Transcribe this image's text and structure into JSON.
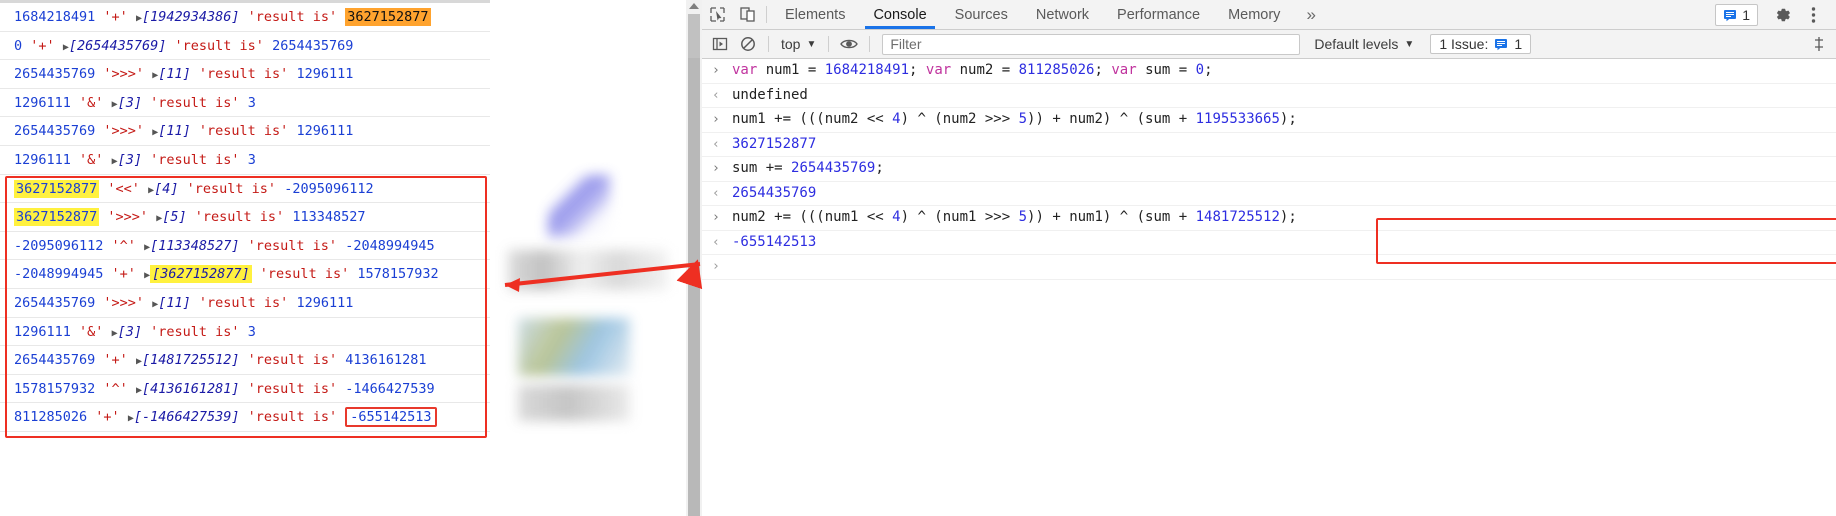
{
  "left_log": {
    "rows": [
      {
        "a": "1684218491",
        "op": "'+'",
        "arr": "[1942934386]",
        "label": "'result is'",
        "res": "3627152877",
        "a_hl": "none",
        "arr_hl": "none",
        "res_hl": "orange"
      },
      {
        "a": "0",
        "op": "'+'",
        "arr": "[2654435769]",
        "label": "'result is'",
        "res": "2654435769",
        "a_hl": "none",
        "arr_hl": "none",
        "res_hl": "none"
      },
      {
        "a": "2654435769",
        "op": "'>>>'",
        "arr": "[11]",
        "label": "'result is'",
        "res": "1296111",
        "a_hl": "none",
        "arr_hl": "none",
        "res_hl": "none"
      },
      {
        "a": "1296111",
        "op": "'&'",
        "arr": "[3]",
        "label": "'result is'",
        "res": "3",
        "a_hl": "none",
        "arr_hl": "none",
        "res_hl": "none"
      },
      {
        "a": "2654435769",
        "op": "'>>>'",
        "arr": "[11]",
        "label": "'result is'",
        "res": "1296111",
        "a_hl": "none",
        "arr_hl": "none",
        "res_hl": "none"
      },
      {
        "a": "1296111",
        "op": "'&'",
        "arr": "[3]",
        "label": "'result is'",
        "res": "3",
        "a_hl": "none",
        "arr_hl": "none",
        "res_hl": "none"
      },
      {
        "a": "3627152877",
        "op": "'<<'",
        "arr": "[4]",
        "label": "'result is'",
        "res": "-2095096112",
        "a_hl": "yellow",
        "arr_hl": "none",
        "res_hl": "none"
      },
      {
        "a": "3627152877",
        "op": "'>>>'",
        "arr": "[5]",
        "label": "'result is'",
        "res": "113348527",
        "a_hl": "yellow",
        "arr_hl": "none",
        "res_hl": "none"
      },
      {
        "a": "-2095096112",
        "op": "'^'",
        "arr": "[113348527]",
        "label": "'result is'",
        "res": "-2048994945",
        "a_hl": "none",
        "arr_hl": "none",
        "res_hl": "none"
      },
      {
        "a": "-2048994945",
        "op": "'+'",
        "arr": "[3627152877]",
        "label": "'result is'",
        "res": "1578157932",
        "a_hl": "none",
        "arr_hl": "yellow",
        "res_hl": "none"
      },
      {
        "a": "2654435769",
        "op": "'>>>'",
        "arr": "[11]",
        "label": "'result is'",
        "res": "1296111",
        "a_hl": "none",
        "arr_hl": "none",
        "res_hl": "none"
      },
      {
        "a": "1296111",
        "op": "'&'",
        "arr": "[3]",
        "label": "'result is'",
        "res": "3",
        "a_hl": "none",
        "arr_hl": "none",
        "res_hl": "none"
      },
      {
        "a": "2654435769",
        "op": "'+'",
        "arr": "[1481725512]",
        "label": "'result is'",
        "res": "4136161281",
        "a_hl": "none",
        "arr_hl": "none",
        "res_hl": "none"
      },
      {
        "a": "1578157932",
        "op": "'^'",
        "arr": "[4136161281]",
        "label": "'result is'",
        "res": "-1466427539",
        "a_hl": "none",
        "arr_hl": "none",
        "res_hl": "none"
      },
      {
        "a": "811285026",
        "op": "'+'",
        "arr": "[-1466427539]",
        "label": "'result is'",
        "res": "-655142513",
        "a_hl": "none",
        "arr_hl": "none",
        "res_hl": "redbox"
      }
    ]
  },
  "devtools": {
    "tabs": [
      {
        "label": "Elements",
        "active": false
      },
      {
        "label": "Console",
        "active": true
      },
      {
        "label": "Sources",
        "active": false
      },
      {
        "label": "Network",
        "active": false
      },
      {
        "label": "Performance",
        "active": false
      },
      {
        "label": "Memory",
        "active": false
      }
    ],
    "more_tabs_label": "»",
    "inspect_icon": "cursor-inspect-icon",
    "device_icon": "device-toolbar-icon",
    "message_badge_count": "1",
    "settings_icon": "gear-icon",
    "kebab_icon": "more-vertical-icon",
    "console_toolbar": {
      "sidebar_toggle_icon": "console-sidebar-icon",
      "clear_icon": "clear-console-icon",
      "context_label": "top",
      "eye_icon": "live-expression-eye-icon",
      "filter_placeholder": "Filter",
      "filter_value": "",
      "levels_label": "Default levels",
      "issues_label": "1 Issue:",
      "issues_count": "1",
      "settings_tail_icon": "console-settings-icon"
    },
    "messages": [
      {
        "kind": "input",
        "gutter": "›",
        "tokens": [
          {
            "t": "var ",
            "c": "kw"
          },
          {
            "t": "num1 ",
            "c": "pln"
          },
          {
            "t": "= ",
            "c": "pln"
          },
          {
            "t": "1684218491",
            "c": "num"
          },
          {
            "t": "; ",
            "c": "pln"
          },
          {
            "t": "var ",
            "c": "kw"
          },
          {
            "t": "num2 ",
            "c": "pln"
          },
          {
            "t": "= ",
            "c": "pln"
          },
          {
            "t": "811285026",
            "c": "num"
          },
          {
            "t": "; ",
            "c": "pln"
          },
          {
            "t": "var ",
            "c": "kw"
          },
          {
            "t": "sum ",
            "c": "pln"
          },
          {
            "t": "= ",
            "c": "pln"
          },
          {
            "t": "0",
            "c": "num"
          },
          {
            "t": ";",
            "c": "pln"
          }
        ]
      },
      {
        "kind": "undef",
        "gutter": "‹",
        "tokens": [
          {
            "t": "undefined",
            "c": "pln"
          }
        ]
      },
      {
        "kind": "input",
        "gutter": "›",
        "tokens": [
          {
            "t": "num1 += (((num2 << ",
            "c": "pln"
          },
          {
            "t": "4",
            "c": "num"
          },
          {
            "t": ") ^ (num2 >>> ",
            "c": "pln"
          },
          {
            "t": "5",
            "c": "num"
          },
          {
            "t": ")) + num2) ^ (sum + ",
            "c": "pln"
          },
          {
            "t": "1195533665",
            "c": "num"
          },
          {
            "t": ");",
            "c": "pln"
          }
        ]
      },
      {
        "kind": "output",
        "gutter": "‹",
        "tokens": [
          {
            "t": "3627152877",
            "c": "num"
          }
        ]
      },
      {
        "kind": "input",
        "gutter": "›",
        "tokens": [
          {
            "t": "sum += ",
            "c": "pln"
          },
          {
            "t": "2654435769",
            "c": "num"
          },
          {
            "t": ";",
            "c": "pln"
          }
        ]
      },
      {
        "kind": "output",
        "gutter": "‹",
        "tokens": [
          {
            "t": "2654435769",
            "c": "num"
          }
        ]
      },
      {
        "kind": "input",
        "gutter": "›",
        "tokens": [
          {
            "t": "num2 += (((num1 << ",
            "c": "pln"
          },
          {
            "t": "4",
            "c": "num"
          },
          {
            "t": ") ^ (num1 >>> ",
            "c": "pln"
          },
          {
            "t": "5",
            "c": "num"
          },
          {
            "t": ")) + num1) ^ (sum + ",
            "c": "pln"
          },
          {
            "t": "1481725512",
            "c": "num"
          },
          {
            "t": ");",
            "c": "pln"
          }
        ]
      },
      {
        "kind": "output",
        "gutter": "‹",
        "tokens": [
          {
            "t": "-655142513",
            "c": "num"
          }
        ]
      },
      {
        "kind": "prompt",
        "gutter": "›",
        "tokens": []
      }
    ]
  },
  "annotations": {
    "highlight_color": "#ee2f22",
    "yellow_color": "#fff13f",
    "orange_color": "#ffa32e",
    "arrow_name": "red-pointer-arrow"
  }
}
